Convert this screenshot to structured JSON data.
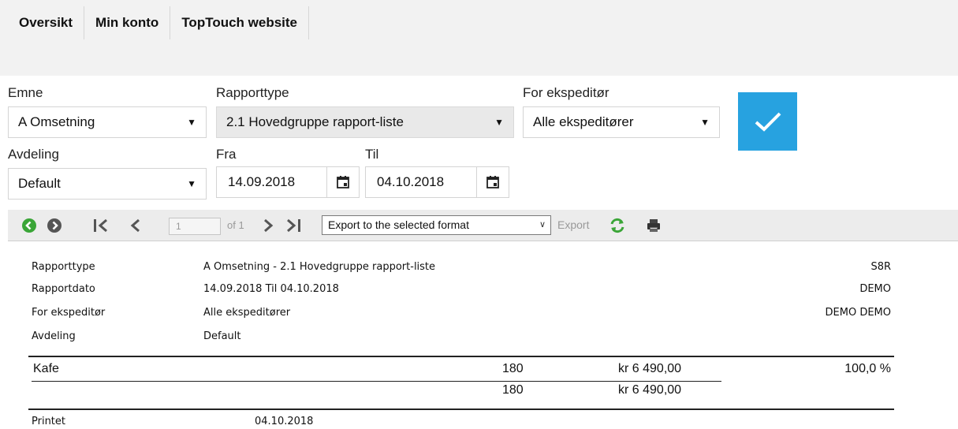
{
  "nav": {
    "tabs": [
      "Oversikt",
      "Min konto",
      "TopTouch website"
    ]
  },
  "filters": {
    "emne": {
      "label": "Emne",
      "value": "A Omsetning"
    },
    "rapporttype": {
      "label": "Rapporttype",
      "value": "2.1 Hovedgruppe rapport-liste"
    },
    "ekspeditor": {
      "label": "For ekspeditør",
      "value": "Alle ekspeditører"
    },
    "avdeling": {
      "label": "Avdeling",
      "value": "Default"
    },
    "fra": {
      "label": "Fra",
      "value": "14.09.2018"
    },
    "til": {
      "label": "Til",
      "value": "04.10.2018"
    }
  },
  "toolbar": {
    "page": "1",
    "of": "of 1",
    "export_format": "Export to the selected format",
    "export_label": "Export",
    "icons": [
      "back-icon",
      "forward-icon",
      "first-page-icon",
      "prev-page-icon",
      "next-page-icon",
      "last-page-icon",
      "refresh-icon",
      "print-icon"
    ]
  },
  "report": {
    "meta": [
      {
        "label": "Rapporttype",
        "value": "A Omsetning - 2.1 Hovedgruppe rapport-liste",
        "right": "S8R"
      },
      {
        "label": "Rapportdato",
        "value": "14.09.2018 Til 04.10.2018",
        "right": "DEMO"
      },
      {
        "label": "For ekspeditør",
        "value": "Alle ekspeditører",
        "right": "DEMO DEMO"
      },
      {
        "label": "Avdeling",
        "value": "Default",
        "right": ""
      }
    ],
    "row": {
      "name": "Kafe",
      "count": "180",
      "amount": "kr 6 490,00",
      "percent": "100,0 %"
    },
    "total": {
      "count": "180",
      "amount": "kr 6 490,00"
    },
    "printed": {
      "label": "Printet",
      "value": "04.10.2018"
    }
  },
  "colors": {
    "accent": "#27a2e0",
    "green": "#3aa537",
    "topbar": "#f2f2f2"
  }
}
